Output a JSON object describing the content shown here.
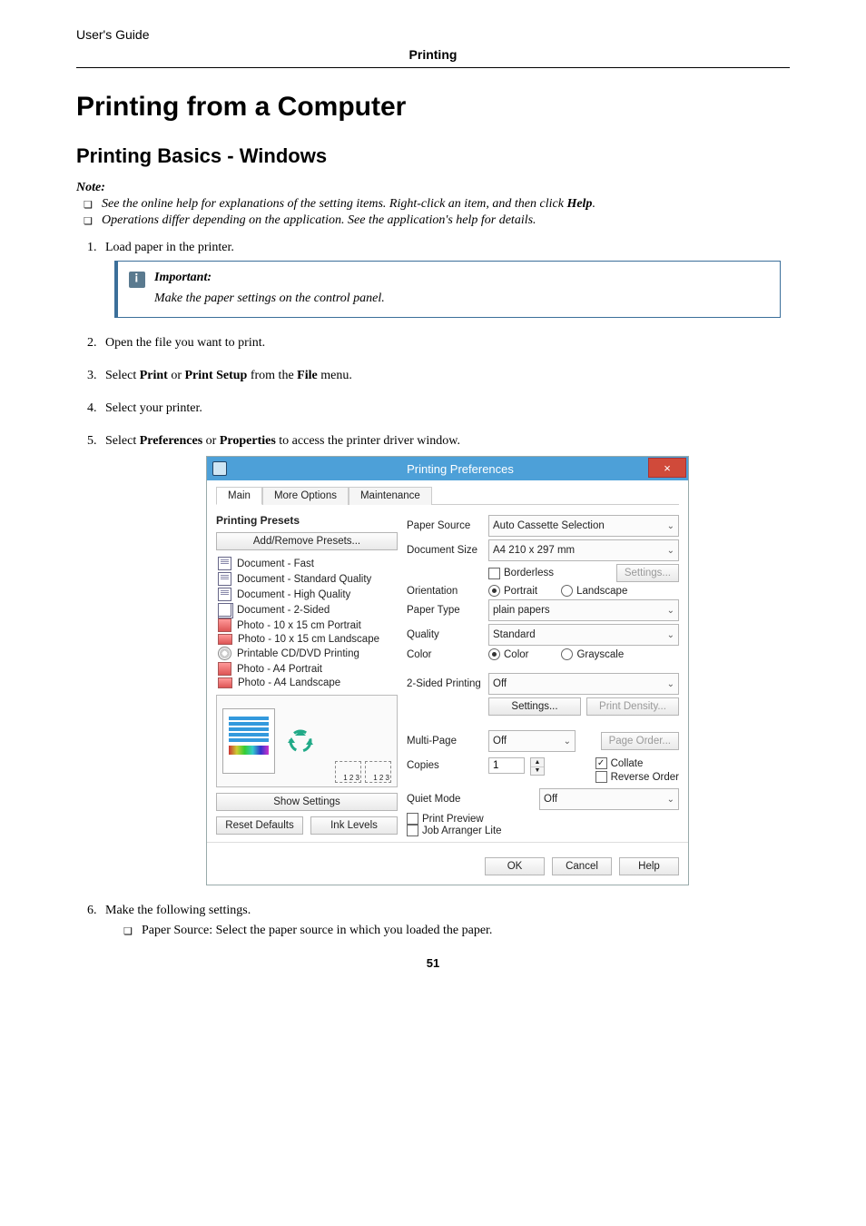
{
  "header": {
    "guide": "User's Guide",
    "section": "Printing"
  },
  "title": "Printing from a Computer",
  "subtitle": "Printing Basics - Windows",
  "note": {
    "label": "Note:",
    "items": [
      {
        "pre": "See the online help for explanations of the setting items. Right-click an item, and then click ",
        "bold": "Help",
        "post": "."
      },
      {
        "pre": "Operations differ depending on the application. See the application's help for details.",
        "bold": "",
        "post": ""
      }
    ]
  },
  "steps": {
    "s1": "Load paper in the printer.",
    "important": {
      "title": "Important:",
      "text": "Make the paper settings on the control panel."
    },
    "s2": "Open the file you want to print.",
    "s3": {
      "pre": "Select ",
      "b1": "Print",
      "mid": " or ",
      "b2": "Print Setup",
      "mid2": " from the ",
      "b3": "File",
      "post": " menu."
    },
    "s4": "Select your printer.",
    "s5": {
      "pre": "Select ",
      "b1": "Preferences",
      "mid": " or ",
      "b2": "Properties",
      "post": " to access the printer driver window."
    },
    "s6": "Make the following settings.",
    "s6_bullet": "Paper Source: Select the paper source in which you loaded the paper."
  },
  "dialog": {
    "title": "Printing Preferences",
    "close": "×",
    "tabs": [
      "Main",
      "More Options",
      "Maintenance"
    ],
    "presets_title": "Printing Presets",
    "add_remove": "Add/Remove Presets...",
    "presets": [
      "Document - Fast",
      "Document - Standard Quality",
      "Document - High Quality",
      "Document - 2-Sided",
      "Photo - 10 x 15 cm Portrait",
      "Photo - 10 x 15 cm Landscape",
      "Printable CD/DVD Printing",
      "Photo - A4 Portrait",
      "Photo - A4 Landscape"
    ],
    "show_settings": "Show Settings",
    "reset_defaults": "Reset Defaults",
    "ink_levels": "Ink Levels",
    "labels": {
      "paper_source": "Paper Source",
      "document_size": "Document Size",
      "borderless": "Borderless",
      "settings": "Settings...",
      "orientation": "Orientation",
      "portrait": "Portrait",
      "landscape": "Landscape",
      "paper_type": "Paper Type",
      "quality": "Quality",
      "color": "Color",
      "color_opt": "Color",
      "grayscale": "Grayscale",
      "twosided": "2-Sided Printing",
      "settings2": "Settings...",
      "print_density": "Print Density...",
      "multipage": "Multi-Page",
      "page_order": "Page Order...",
      "copies": "Copies",
      "collate": "Collate",
      "reverse": "Reverse Order",
      "quiet": "Quiet Mode",
      "print_preview": "Print Preview",
      "job_arranger": "Job Arranger Lite"
    },
    "values": {
      "paper_source": "Auto Cassette Selection",
      "document_size": "A4 210 x 297 mm",
      "paper_type": "plain papers",
      "quality": "Standard",
      "twosided": "Off",
      "multipage": "Off",
      "copies": "1",
      "quiet": "Off"
    },
    "footer": {
      "ok": "OK",
      "cancel": "Cancel",
      "help": "Help"
    }
  },
  "page_number": "51"
}
